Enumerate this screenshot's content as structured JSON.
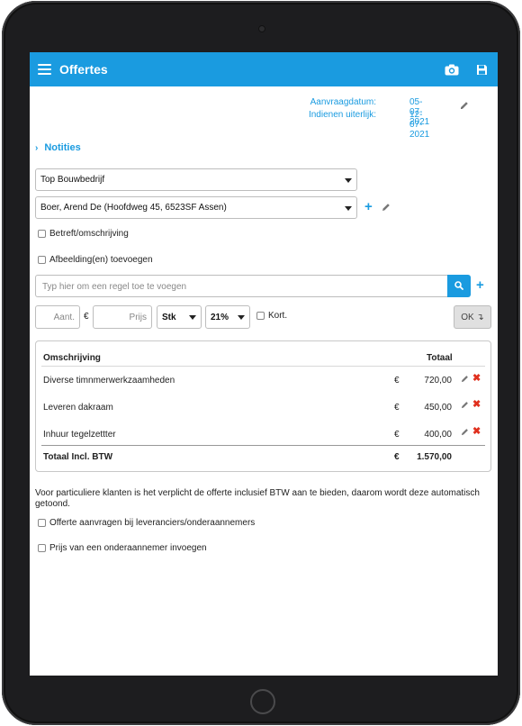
{
  "app": {
    "title": "Offertes"
  },
  "icons": {
    "menu": "hamburger-menu-icon",
    "camera": "camera-icon",
    "save": "save-icon",
    "edit": "pencil-icon",
    "delete": "close-x-icon",
    "search": "search-icon",
    "add": "plus-icon"
  },
  "colors": {
    "accent": "#1a9be0",
    "delete": "#e0301e"
  },
  "dates": {
    "requested_label": "Aanvraagdatum:",
    "requested_value": "05-07-2021",
    "deadline_label": "Indienen uiterlijk:",
    "deadline_value": "12-07-2021"
  },
  "notes": {
    "label": "Notities",
    "chevron": "›"
  },
  "company_select": {
    "value": "Top Bouwbedrijf"
  },
  "contact_select": {
    "value": "Boer, Arend De (Hoofdweg 45, 6523SF Assen)"
  },
  "checkboxes": {
    "subject": "Betreft/omschrijving",
    "images": "Afbeelding(en) toevoegen",
    "suppliers": "Offerte aanvragen bij leveranciers/onderaannemers",
    "subcontractor_price": "Prijs van een onderaannemer invoegen"
  },
  "line_entry": {
    "placeholder": "Typ hier om een regel toe te voegen",
    "qty_placeholder": "Aant.",
    "currency": "€",
    "price_placeholder": "Prijs",
    "unit": "Stk",
    "vat": "21%",
    "discount_label": "Kort.",
    "ok_label": "OK ↴",
    "plus": "+"
  },
  "table": {
    "col_description": "Omschrijving",
    "col_total": "Totaal",
    "rows": [
      {
        "description": "Diverse timnmerwerkzaamheden",
        "currency": "€",
        "amount": "720,00"
      },
      {
        "description": "Leveren dakraam",
        "currency": "€",
        "amount": "450,00"
      },
      {
        "description": "Inhuur tegelzettter",
        "currency": "€",
        "amount": "400,00"
      }
    ],
    "total_label": "Totaal Incl. BTW",
    "total_currency": "€",
    "total_amount": "1.570,00"
  },
  "info": {
    "text": "Voor particuliere klanten is het verplicht de offerte inclusief BTW aan te bieden, daarom wordt deze automatisch getoond."
  }
}
